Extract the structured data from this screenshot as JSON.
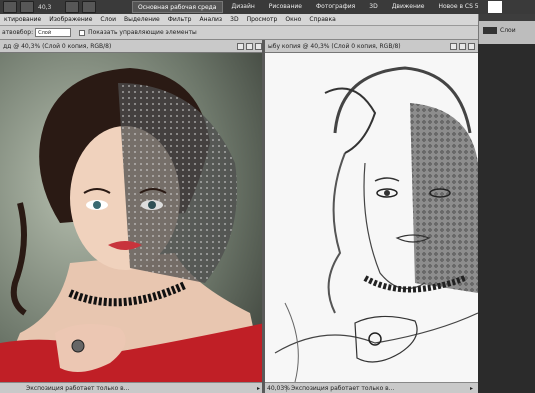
{
  "appbar": {
    "zoom": "40,3",
    "workspaces": [
      "Основная рабочая среда",
      "Дизайн",
      "Рисование",
      "Фотография",
      "3D",
      "Движение",
      "Новое в CS 5"
    ]
  },
  "menu": [
    "ктирование",
    "Изображение",
    "Слои",
    "Выделение",
    "Фильтр",
    "Анализ",
    "3D",
    "Просмотр",
    "Окно",
    "Справка"
  ],
  "options": {
    "tool_label": "атвовбор:",
    "layer_select": "Слой",
    "checkbox_label": "Показать управляющие элементы"
  },
  "panel": {
    "layers_label": "Слои"
  },
  "doc_left": {
    "tab": "дд @ 40,3% (Слой 0 копия, RGB/8)",
    "status_pct": "",
    "status_msg": "Экспозиция работает только в..."
  },
  "doc_right": {
    "tab": "ыбу копия @ 40,3% (Слой 0 копия, RGB/8)",
    "status_pct": "40,03%",
    "status_msg": "Экспозиция работает только в..."
  },
  "colors": {
    "chrome_dark": "#2b2b2b",
    "chrome_light": "#d6d6d6",
    "dress_red": "#c01f26"
  }
}
